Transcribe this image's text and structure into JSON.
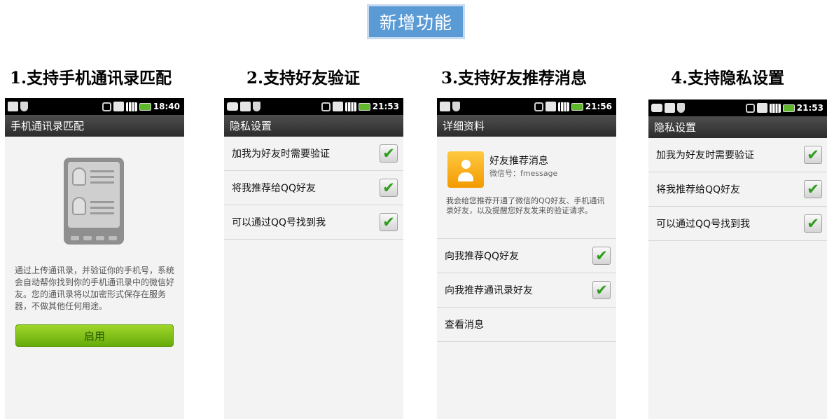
{
  "banner": "新增功能",
  "panels": [
    {
      "heading": "1.支持手机通讯录匹配",
      "time": "18:40",
      "title": "手机通讯录匹配",
      "description": "通过上传通讯录，并验证你的手机号，系统会自动帮你找到你的手机通讯录中的微信好友。您的通讯录将以加密形式保存在服务器，不做其他任何用途。",
      "button": "启用"
    },
    {
      "heading": "2.支持好友验证",
      "time": "21:53",
      "title": "隐私设置",
      "rows": [
        "加我为好友时需要验证",
        "将我推荐给QQ好友",
        "可以通过QQ号找到我"
      ],
      "checked": [
        true,
        true,
        true
      ]
    },
    {
      "heading": "3.支持好友推荐消息",
      "time": "21:56",
      "title": "详细资料",
      "profile": {
        "name": "好友推荐消息",
        "id": "微信号：fmessage",
        "description": "我会给您推荐开通了微信的QQ好友、手机通讯录好友，以及提醒您好友发来的验证请求。"
      },
      "rows": [
        "向我推荐QQ好友",
        "向我推荐通讯录好友",
        "查看消息"
      ],
      "checked": [
        true,
        true,
        false
      ]
    },
    {
      "heading": "4.支持隐私设置",
      "time": "21:53",
      "title": "隐私设置",
      "rows": [
        "加我为好友时需要验证",
        "将我推荐给QQ好友",
        "可以通过QQ号找到我"
      ],
      "checked": [
        true,
        true,
        true
      ]
    }
  ],
  "icons": {
    "status_left": [
      "chat-icon",
      "usb-icon",
      "shield-icon"
    ],
    "status_right": [
      "vibrate-icon",
      "network-icon",
      "signal-icon",
      "battery-icon"
    ],
    "check": "✔"
  }
}
